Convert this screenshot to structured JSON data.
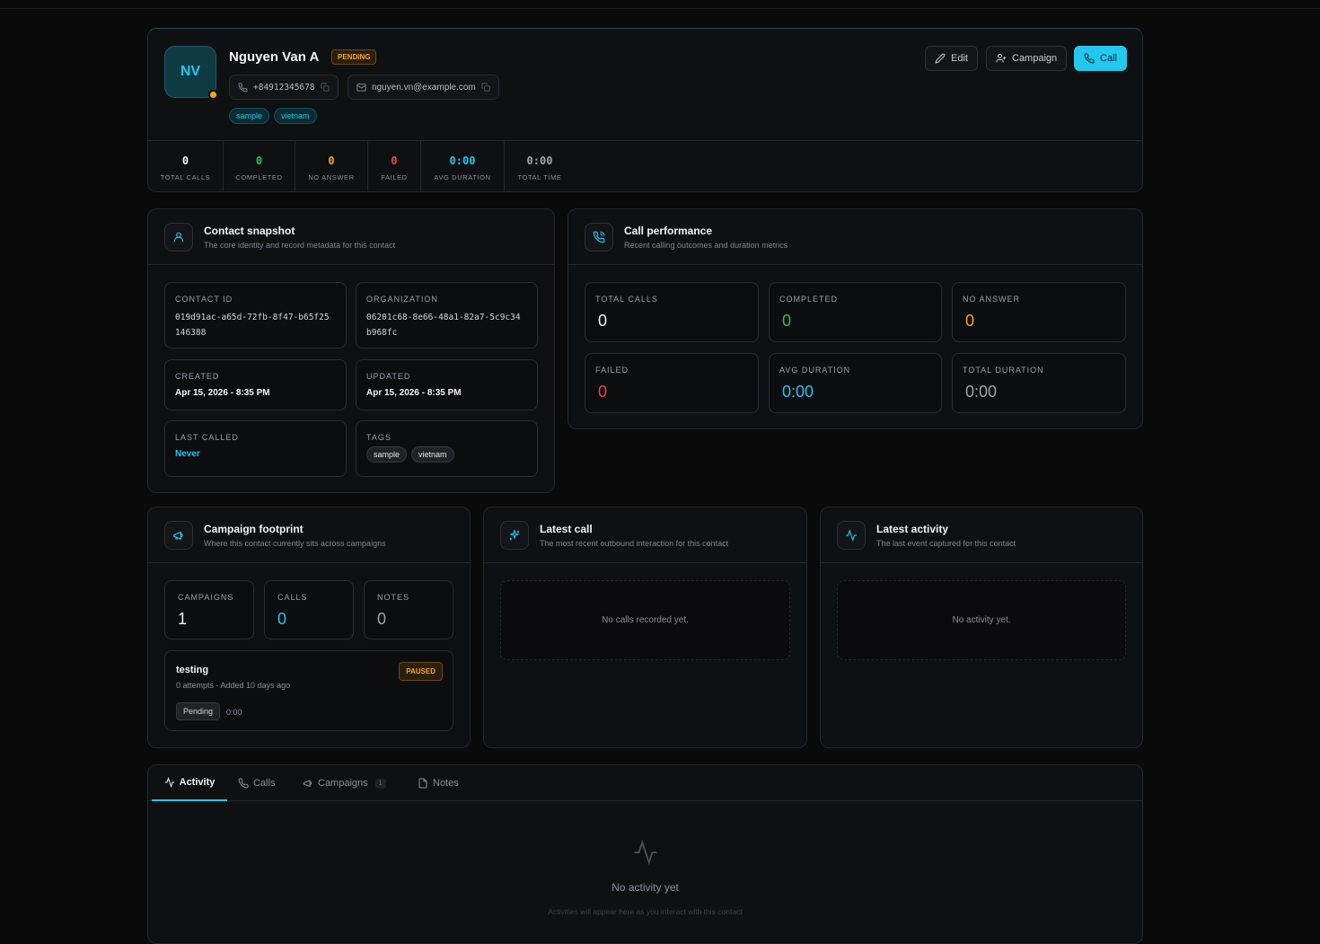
{
  "contact": {
    "initials": "NV",
    "name": "Nguyen Van A",
    "status": "PENDING",
    "phone": "+84912345678",
    "email": "nguyen.vn@example.com",
    "tags": [
      "sample",
      "vietnam"
    ]
  },
  "actions": {
    "edit": "Edit",
    "campaign": "Campaign",
    "call": "Call"
  },
  "summary_stats": [
    {
      "value": "0",
      "label": "TOTAL CALLS"
    },
    {
      "value": "0",
      "label": "COMPLETED"
    },
    {
      "value": "0",
      "label": "NO ANSWER"
    },
    {
      "value": "0",
      "label": "FAILED"
    },
    {
      "value": "0:00",
      "label": "AVG DURATION"
    },
    {
      "value": "0:00",
      "label": "TOTAL TIME"
    }
  ],
  "snapshot": {
    "title": "Contact snapshot",
    "subtitle": "The core identity and record metadata for this contact",
    "contact_id_label": "CONTACT ID",
    "contact_id": "019d91ac-a65d-72fb-8f47-b65f25146388",
    "org_label": "ORGANIZATION",
    "org_id": "06201c68-8e66-48a1-82a7-5c9c34b968fc",
    "created_label": "CREATED",
    "created": "Apr 15, 2026 - 8:35 PM",
    "updated_label": "UPDATED",
    "updated": "Apr 15, 2026 - 8:35 PM",
    "last_called_label": "LAST CALLED",
    "last_called": "Never",
    "tags_label": "TAGS",
    "tags": [
      "sample",
      "vietnam"
    ]
  },
  "performance": {
    "title": "Call performance",
    "subtitle": "Recent calling outcomes and duration metrics",
    "metrics": [
      {
        "label": "TOTAL CALLS",
        "value": "0"
      },
      {
        "label": "COMPLETED",
        "value": "0"
      },
      {
        "label": "NO ANSWER",
        "value": "0"
      },
      {
        "label": "FAILED",
        "value": "0"
      },
      {
        "label": "AVG DURATION",
        "value": "0:00"
      },
      {
        "label": "TOTAL DURATION",
        "value": "0:00"
      }
    ]
  },
  "footprint": {
    "title": "Campaign footprint",
    "subtitle": "Where this contact currently sits across campaigns",
    "campaigns_label": "CAMPAIGNS",
    "campaigns": "1",
    "calls_label": "CALLS",
    "calls": "0",
    "notes_label": "NOTES",
    "notes": "0",
    "item": {
      "name": "testing",
      "status": "PAUSED",
      "meta": "0 attempts - Added 10 days ago",
      "state": "Pending",
      "duration": "0:00"
    }
  },
  "latest_call": {
    "title": "Latest call",
    "subtitle": "The most recent outbound interaction for this contact",
    "empty": "No calls recorded yet."
  },
  "latest_activity": {
    "title": "Latest activity",
    "subtitle": "The last event captured for this contact",
    "empty": "No activity yet."
  },
  "tabs": [
    {
      "label": "Activity"
    },
    {
      "label": "Calls"
    },
    {
      "label": "Campaigns",
      "count": "1"
    },
    {
      "label": "Notes"
    }
  ],
  "activity_empty": {
    "title": "No activity yet",
    "subtitle": "Activities will appear here as you interact with this contact"
  },
  "colors": {
    "accent": "#22c8ee",
    "completed": "#22c55e",
    "no_answer": "#f5a524",
    "failed": "#ef4444"
  }
}
